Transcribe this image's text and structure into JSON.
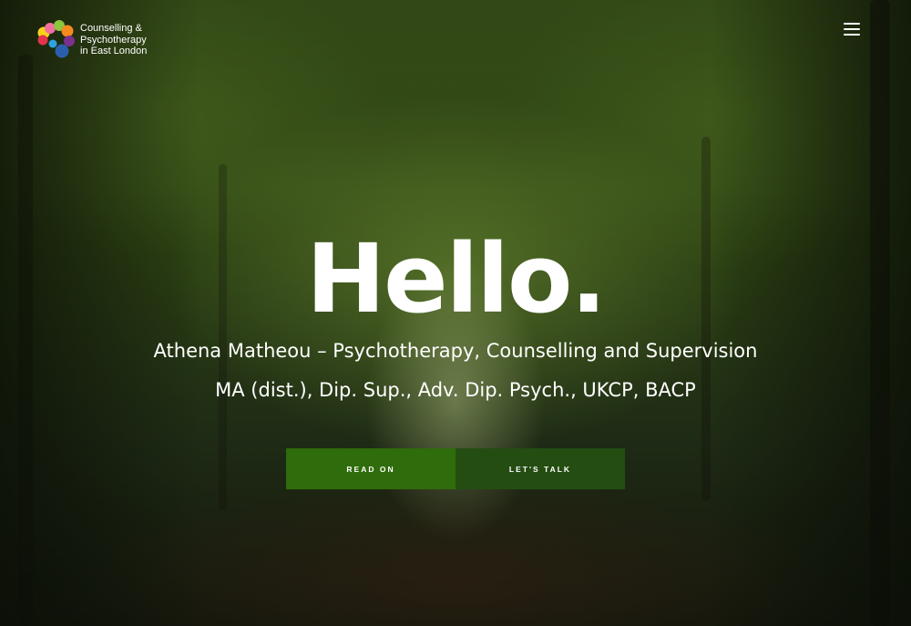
{
  "brand": {
    "name_lines": [
      "Counselling &",
      "Psychotherapy",
      "in East London"
    ],
    "logo_colors": [
      "#f7d21b",
      "#e5334b",
      "#8dc63f",
      "#f26f9f",
      "#f58a1f",
      "#7b2f8e",
      "#2b5fae",
      "#2fa3dc"
    ]
  },
  "nav": {
    "menu_icon": "hamburger-icon"
  },
  "hero": {
    "title": "Hello.",
    "subtitle": "Athena Matheou – Psychotherapy, Counselling and Supervision",
    "credentials": "MA (dist.), Dip. Sup., Adv. Dip. Psych., UKCP, BACP"
  },
  "buttons": {
    "read_on": "READ ON",
    "lets_talk": "LET'S TALK"
  },
  "colors": {
    "read_on_bg": "#2f6c0c",
    "lets_talk_bg": "#244d12"
  }
}
